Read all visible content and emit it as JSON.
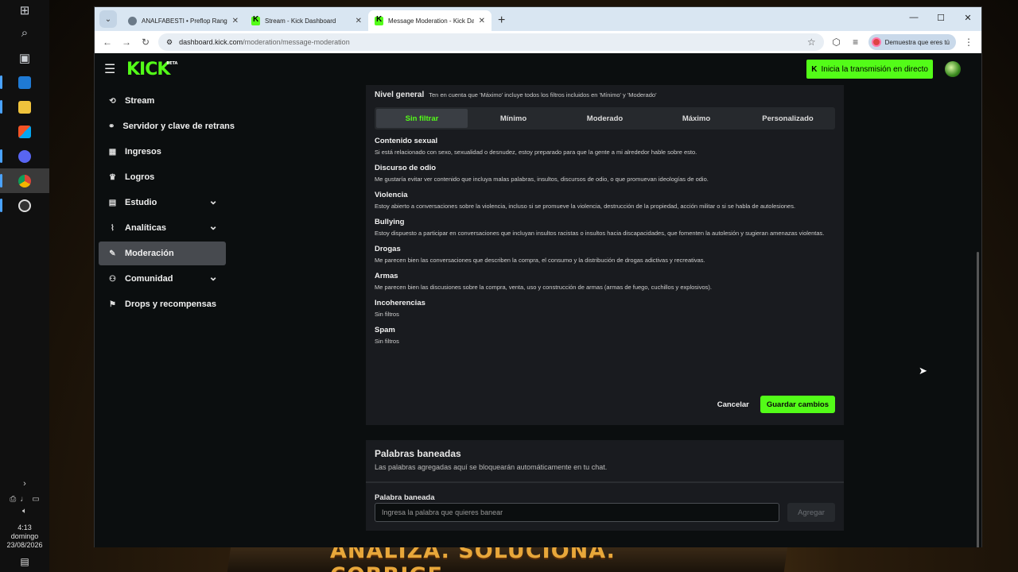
{
  "taskbar": {
    "time": "4:13",
    "day": "domingo",
    "date": "23/08/2026"
  },
  "banner": {
    "text": "ANALIZA. SOLUCIONA. CORRIGE."
  },
  "browser": {
    "tabs": [
      {
        "title": "ANALFABESTI • Preflop Range V",
        "icon": "globe-icon"
      },
      {
        "title": "Stream - Kick Dashboard",
        "icon": "kick-icon"
      },
      {
        "title": "Message Moderation - Kick Das",
        "icon": "kick-icon"
      }
    ],
    "url_domain": "dashboard.kick.com",
    "url_path": "/moderation/message-moderation",
    "profile_label": "Demuestra que eres tú"
  },
  "kick": {
    "logo": "KICK",
    "logo_badge": "BETA",
    "go_live": "Inicia la transmisión en directo",
    "sidebar": [
      {
        "label": "Stream",
        "icon": "⟲",
        "chevron": false,
        "active": false
      },
      {
        "label": "Servidor y clave de retrans",
        "icon": "⚭",
        "chevron": false,
        "active": false
      },
      {
        "label": "Ingresos",
        "icon": "▦",
        "chevron": false,
        "active": false
      },
      {
        "label": "Logros",
        "icon": "♛",
        "chevron": false,
        "active": false
      },
      {
        "label": "Estudio",
        "icon": "▤",
        "chevron": true,
        "active": false
      },
      {
        "label": "Analíticas",
        "icon": "⌇",
        "chevron": true,
        "active": false
      },
      {
        "label": "Moderación",
        "icon": "✎",
        "chevron": false,
        "active": true
      },
      {
        "label": "Comunidad",
        "icon": "⚇",
        "chevron": true,
        "active": false
      },
      {
        "label": "Drops y recompensas",
        "icon": "⚑",
        "chevron": false,
        "active": false
      }
    ],
    "level": {
      "title": "Nivel general",
      "desc": "Ten en cuenta que 'Máximo' incluye todos los filtros incluidos en 'Mínimo' y 'Moderado'",
      "options": [
        "Sin filtrar",
        "Mínimo",
        "Moderado",
        "Máximo",
        "Personalizado"
      ],
      "selected": "Sin filtrar"
    },
    "categories": [
      {
        "title": "Contenido sexual",
        "desc": "Si está relacionado con sexo, sexualidad o desnudez, estoy preparado para que la gente a mi alrededor hable sobre esto."
      },
      {
        "title": "Discurso de odio",
        "desc": "Me gustaría evitar ver contenido que incluya malas palabras, insultos, discursos de odio, o que promuevan ideologías de odio."
      },
      {
        "title": "Violencia",
        "desc": "Estoy abierto a conversaciones sobre la violencia, incluso si se promueve la violencia, destrucción de la propiedad, acción militar o si se habla de autolesiones."
      },
      {
        "title": "Bullying",
        "desc": "Estoy dispuesto a participar en conversaciones que incluyan insultos racistas o insultos hacia discapacidades, que fomenten la autolesión y sugieran amenazas violentas."
      },
      {
        "title": "Drogas",
        "desc": "Me parecen bien las conversaciones que describen la compra, el consumo y la distribución de drogas adictivas y recreativas."
      },
      {
        "title": "Armas",
        "desc": "Me parecen bien las discusiones sobre la compra, venta, uso y construcción de armas (armas de fuego, cuchillos y explosivos)."
      },
      {
        "title": "Incoherencias",
        "desc": "Sin filtros"
      },
      {
        "title": "Spam",
        "desc": "Sin filtros"
      }
    ],
    "cancel": "Cancelar",
    "save": "Guardar cambios",
    "banned": {
      "title": "Palabras baneadas",
      "subtitle": "Las palabras agregadas aquí se bloquearán automáticamente en tu chat.",
      "field_label": "Palabra baneada",
      "placeholder": "Ingresa la palabra que quieres banear",
      "add": "Agregar"
    }
  }
}
